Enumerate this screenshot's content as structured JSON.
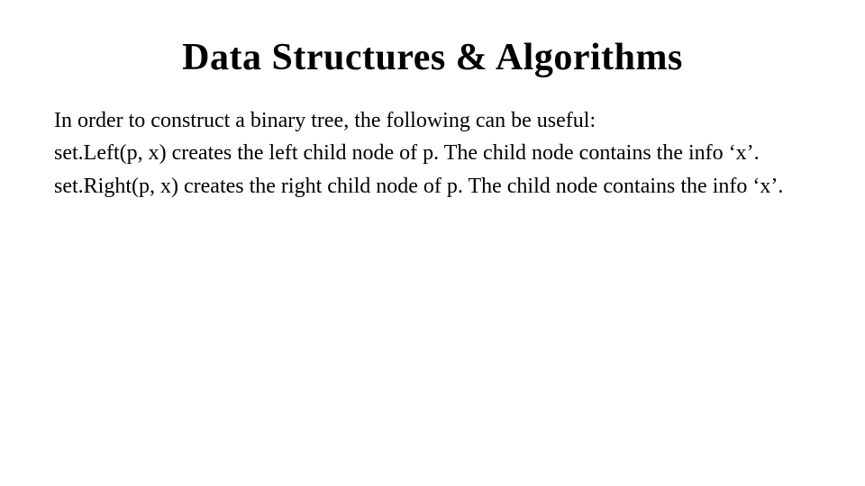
{
  "slide": {
    "title": "Data Structures & Algorithms",
    "paragraphs": {
      "p0": "In order to construct a binary tree, the following can be useful:",
      "p1": "set.Left(p, x) creates the left child node of p. The child node contains the info ‘x’.",
      "p2": "set.Right(p, x) creates the right child node of p. The child node contains the info ‘x’."
    }
  }
}
